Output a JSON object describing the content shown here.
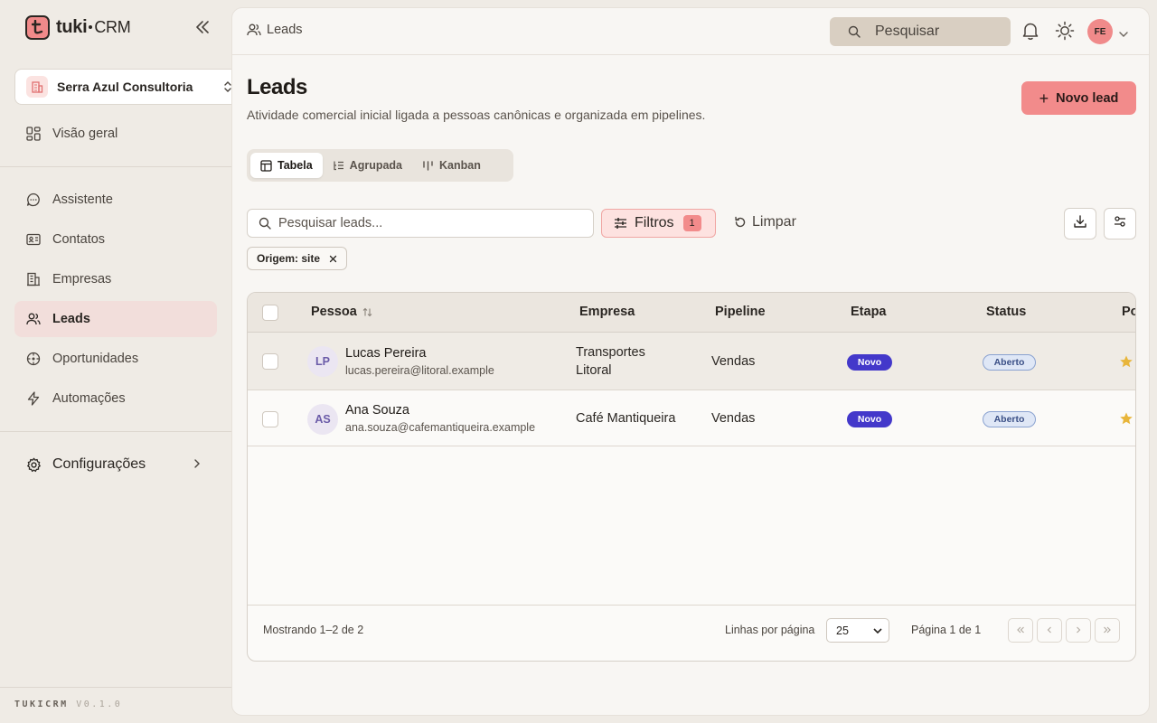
{
  "app": {
    "logo_name": "tuki",
    "logo_suffix": "CRM",
    "version_name": "TUKICRM",
    "version_number": "V0.1.0"
  },
  "org": {
    "name": "Serra Azul Consultoria"
  },
  "sidebar": {
    "items": [
      {
        "label": "Visão geral",
        "icon": "grid-icon"
      },
      {
        "label": "Assistente",
        "icon": "chat-icon"
      },
      {
        "label": "Contatos",
        "icon": "contact-card-icon"
      },
      {
        "label": "Empresas",
        "icon": "building-icon"
      },
      {
        "label": "Leads",
        "icon": "users-icon",
        "active": true
      },
      {
        "label": "Oportunidades",
        "icon": "target-icon"
      },
      {
        "label": "Automações",
        "icon": "bolt-icon"
      }
    ],
    "settings_label": "Configurações"
  },
  "topbar": {
    "breadcrumb": "Leads",
    "search_label": "Pesquisar",
    "user_initials": "FE"
  },
  "page": {
    "title": "Leads",
    "subtitle": "Atividade comercial inicial ligada a pessoas canônicas e organizada em pipelines.",
    "new_button": "Novo lead"
  },
  "views": {
    "tabs": [
      {
        "label": "Tabela",
        "active": true
      },
      {
        "label": "Agrupada"
      },
      {
        "label": "Kanban"
      }
    ]
  },
  "toolbar": {
    "search_placeholder": "Pesquisar leads...",
    "filters_label": "Filtros",
    "filters_count": "1",
    "clear_label": "Limpar",
    "active_filter": "Origem: site"
  },
  "table": {
    "columns": [
      "Pessoa",
      "Empresa",
      "Pipeline",
      "Etapa",
      "Status",
      "Po"
    ],
    "rows": [
      {
        "initials": "LP",
        "name": "Lucas Pereira",
        "email": "lucas.pereira@litoral.example",
        "company_line1": "Transportes",
        "company_line2": "Litoral",
        "pipeline": "Vendas",
        "stage": "Novo",
        "status": "Aberto"
      },
      {
        "initials": "AS",
        "name": "Ana Souza",
        "email": "ana.souza@cafemantiqueira.example",
        "company_line1": "Café Mantiqueira",
        "company_line2": "",
        "pipeline": "Vendas",
        "stage": "Novo",
        "status": "Aberto"
      }
    ]
  },
  "pagination": {
    "showing": "Mostrando 1–2 de 2",
    "rows_per_page_label": "Linhas por página",
    "rows_per_page_value": "25",
    "page_label": "Página 1 de 1"
  },
  "colors": {
    "accent": "#f28b8b",
    "stage_badge": "#4338ca",
    "status_badge": "#dfe7f6",
    "star": "#e8b53a"
  }
}
